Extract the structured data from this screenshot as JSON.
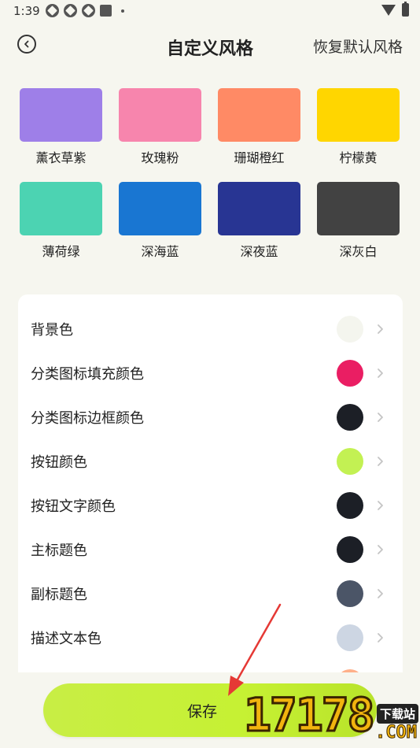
{
  "status_bar": {
    "time": "1:39"
  },
  "header": {
    "title": "自定义风格",
    "reset_label": "恢复默认风格"
  },
  "swatches": [
    {
      "label": "薰衣草紫",
      "color": "#9e7fe8"
    },
    {
      "label": "玫瑰粉",
      "color": "#f785ad"
    },
    {
      "label": "珊瑚橙红",
      "color": "#ff8a65"
    },
    {
      "label": "柠檬黄",
      "color": "#ffd600"
    },
    {
      "label": "薄荷绿",
      "color": "#4cd3b2"
    },
    {
      "label": "深海蓝",
      "color": "#1976d2"
    },
    {
      "label": "深夜蓝",
      "color": "#283593"
    },
    {
      "label": "深灰白",
      "color": "#424242"
    }
  ],
  "settings": [
    {
      "label": "背景色",
      "color": "#f4f5ee"
    },
    {
      "label": "分类图标填充颜色",
      "color": "#ea1e63"
    },
    {
      "label": "分类图标边框颜色",
      "color": "#1c1f26"
    },
    {
      "label": "按钮颜色",
      "color": "#c3f153"
    },
    {
      "label": "按钮文字颜色",
      "color": "#1c1f26"
    },
    {
      "label": "主标题色",
      "color": "#1c1f26"
    },
    {
      "label": "副标题色",
      "color": "#4b5567"
    },
    {
      "label": "描述文本色",
      "color": "#cdd6e3"
    }
  ],
  "partial_setting_color": "#ffb08a",
  "save_button": {
    "label": "保存"
  },
  "watermark": {
    "digits": "17178",
    "tag": "下载站",
    "suffix": ".COM"
  },
  "annotation_color": "#e53935"
}
